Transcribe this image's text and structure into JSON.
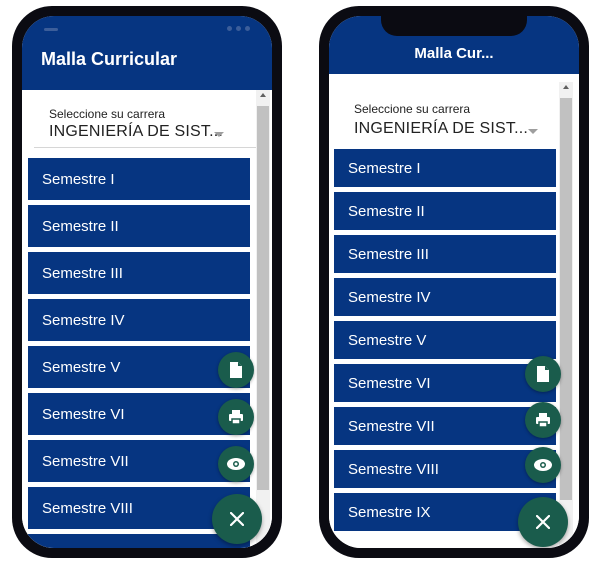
{
  "left_phone": {
    "app_title": "Malla Curricular",
    "selector": {
      "label": "Seleccione su carrera",
      "value": "INGENIERÍA DE SIST..."
    },
    "semesters": [
      "Semestre I",
      "Semestre II",
      "Semestre III",
      "Semestre IV",
      "Semestre V",
      "Semestre VI",
      "Semestre VII",
      "Semestre VIII"
    ]
  },
  "right_phone": {
    "app_title": "Malla Cur...",
    "selector": {
      "label": "Seleccione su carrera",
      "value": "INGENIERÍA DE SIST..."
    },
    "semesters": [
      "Semestre I",
      "Semestre II",
      "Semestre III",
      "Semestre IV",
      "Semestre V",
      "Semestre VI",
      "Semestre VII",
      "Semestre VIII",
      "Semestre IX"
    ]
  },
  "fab_actions": [
    {
      "icon": "file-icon"
    },
    {
      "icon": "print-icon"
    },
    {
      "icon": "eye-icon"
    }
  ],
  "fab_main": {
    "icon": "close-icon"
  },
  "colors": {
    "primary": "#063581",
    "fab": "#1a5c4c",
    "background": "#ffffff"
  }
}
